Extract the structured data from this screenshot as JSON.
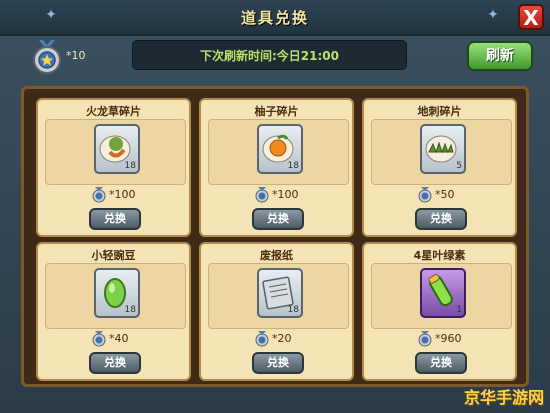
{
  "window": {
    "title": "道具兑换",
    "close_label": "X"
  },
  "header": {
    "medal_count": "*10",
    "refresh_countdown": "下次刷新时间:今日21:00",
    "refresh_label": "刷新"
  },
  "items": [
    {
      "name": "火龙草碎片",
      "count": "18",
      "price": "*100",
      "exchange_label": "兑换"
    },
    {
      "name": "柚子碎片",
      "count": "18",
      "price": "*100",
      "exchange_label": "兑换"
    },
    {
      "name": "地刺碎片",
      "count": "5",
      "price": "*50",
      "exchange_label": "兑换"
    },
    {
      "name": "小轻豌豆",
      "count": "18",
      "price": "*40",
      "exchange_label": "兑换"
    },
    {
      "name": "废报纸",
      "count": "18",
      "price": "*20",
      "exchange_label": "兑换"
    },
    {
      "name": "4星叶绿素",
      "count": "1",
      "price": "*960",
      "exchange_label": "兑换"
    }
  ],
  "watermark": "京华手游网"
}
